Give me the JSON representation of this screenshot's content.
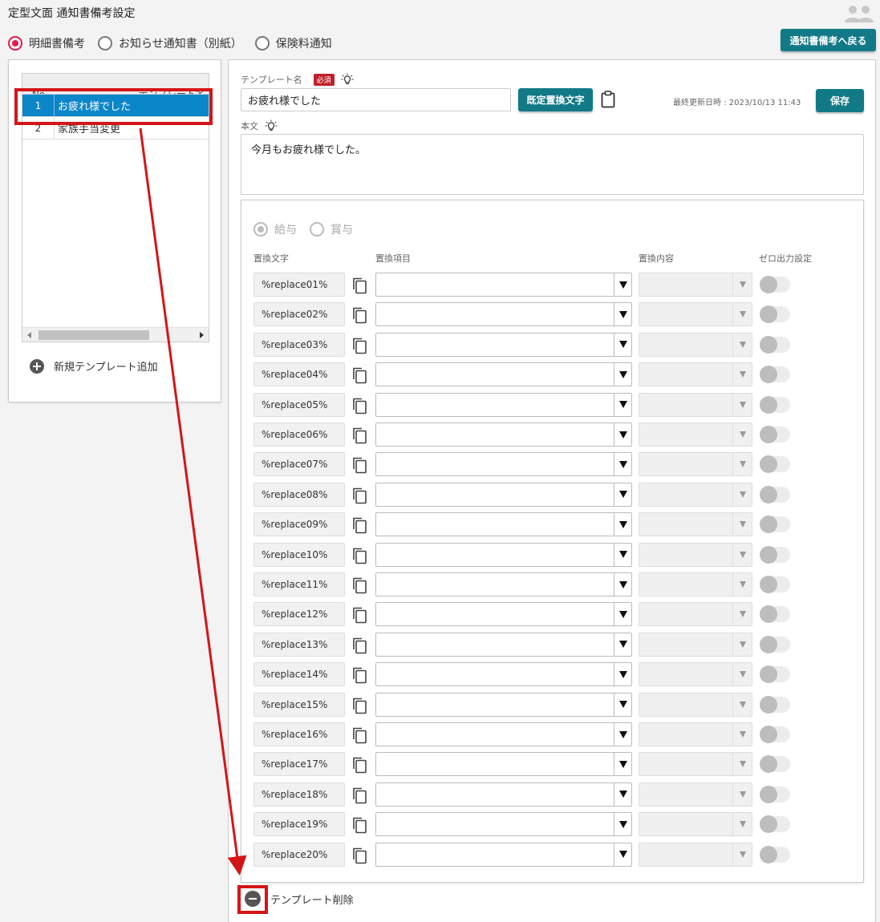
{
  "page": {
    "title": "定型文面 通知書備考設定",
    "back_button": "通知書備考へ戻る"
  },
  "doc_type_radios": [
    {
      "label": "明細書備考",
      "checked": true
    },
    {
      "label": "お知らせ通知書（別紙）",
      "checked": false
    },
    {
      "label": "保険料通知",
      "checked": false
    }
  ],
  "template_list": {
    "columns": {
      "no": "No",
      "name": "テンプレート名"
    },
    "rows": [
      {
        "no": "1",
        "name": "お疲れ様でした",
        "selected": true
      },
      {
        "no": "2",
        "name": "家族手当変更",
        "selected": false
      }
    ],
    "add_label": "新規テンプレート追加"
  },
  "editor": {
    "name_label": "テンプレート名",
    "required_badge": "必須",
    "name_value": "お疲れ様でした",
    "std_replace_button": "既定置換文字",
    "updated_text": "最終更新日時 : 2023/10/13 11:43",
    "save_button": "保存",
    "body_label": "本文",
    "body_value": "今月もお疲れ様でした。"
  },
  "replace_panel": {
    "pay_type_radios": [
      {
        "label": "給与",
        "checked": true
      },
      {
        "label": "賞与",
        "checked": false
      }
    ],
    "columns": {
      "code": "置換文字",
      "item": "置換項目",
      "content": "置換内容",
      "zero": "ゼロ出力設定"
    },
    "rows": [
      "%replace01%",
      "%replace02%",
      "%replace03%",
      "%replace04%",
      "%replace05%",
      "%replace06%",
      "%replace07%",
      "%replace08%",
      "%replace09%",
      "%replace10%",
      "%replace11%",
      "%replace12%",
      "%replace13%",
      "%replace14%",
      "%replace15%",
      "%replace16%",
      "%replace17%",
      "%replace18%",
      "%replace19%",
      "%replace20%"
    ]
  },
  "delete_label": "テンプレート削除",
  "colors": {
    "accent_button": "#127a87",
    "selection": "#0a86c9",
    "radio_on": "#e6194b",
    "annotation": "#d41517",
    "required_badge": "#c0202a"
  }
}
